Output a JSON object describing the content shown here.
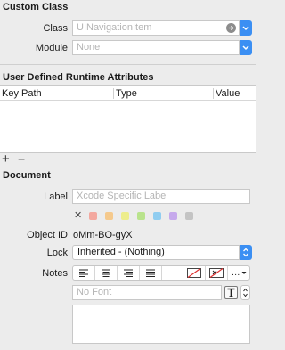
{
  "custom_class": {
    "title": "Custom Class",
    "class_label": "Class",
    "class_placeholder": "UINavigationItem",
    "module_label": "Module",
    "module_placeholder": "None"
  },
  "runtime_attributes": {
    "title": "User Defined Runtime Attributes",
    "columns": [
      "Key Path",
      "Type",
      "Value"
    ],
    "add_symbol": "+",
    "remove_symbol": "−"
  },
  "document": {
    "title": "Document",
    "label_label": "Label",
    "label_placeholder": "Xcode Specific Label",
    "clear_symbol": "✕",
    "swatch_colors": [
      "#f3a89f",
      "#f5c98c",
      "#eded8c",
      "#b9e38c",
      "#90cdf0",
      "#c6a9ec",
      "#c4c4c4"
    ],
    "object_id_label": "Object ID",
    "object_id_value": "oMm-BO-gyX",
    "lock_label": "Lock",
    "lock_value": "Inherited - (Nothing)",
    "notes_label": "Notes",
    "font_placeholder": "No Font",
    "more_symbol": "…"
  },
  "colors": {
    "accent": "#3b8ff3"
  }
}
